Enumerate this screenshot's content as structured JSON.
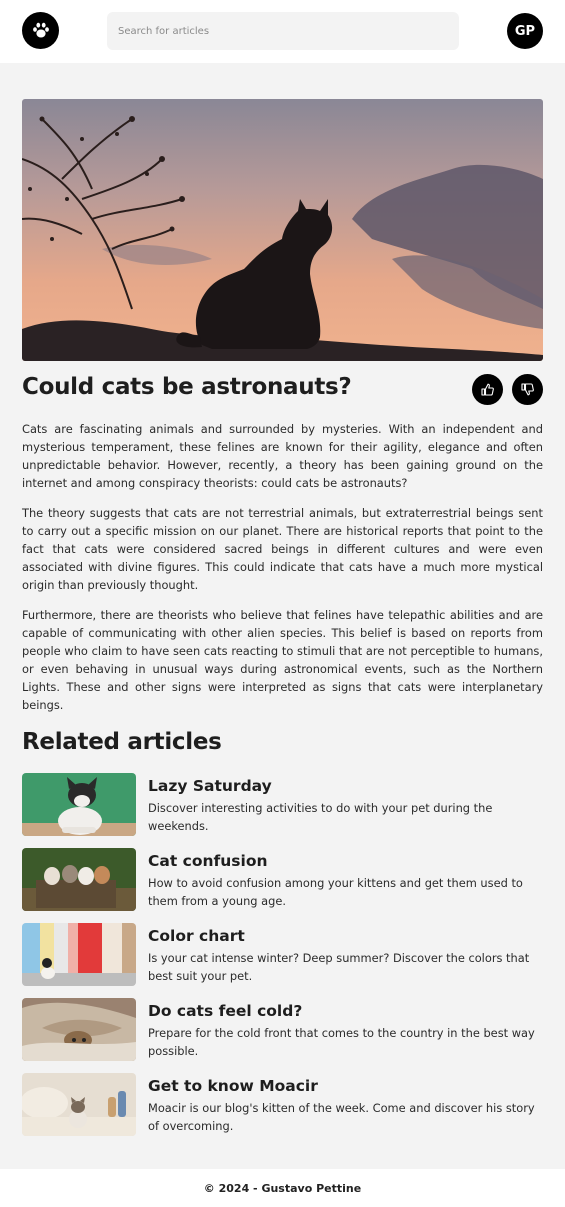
{
  "header": {
    "logo_icon": "paw-icon",
    "search_placeholder": "Search for articles",
    "avatar_initials": "GP"
  },
  "article": {
    "hero_image": "cat-silhouette-at-sunset",
    "title": "Could cats be astronauts?",
    "like_icon": "thumbs-up-icon",
    "dislike_icon": "thumbs-down-icon",
    "paragraphs": [
      "Cats are fascinating animals and surrounded by mysteries. With an independent and mysterious temperament, these felines are known for their agility, elegance and often unpredictable behavior. However, recently, a theory has been gaining ground on the internet and among conspiracy theorists: could cats be astronauts?",
      "The theory suggests that cats are not terrestrial animals, but extraterrestrial beings sent to carry out a specific mission on our planet. There are historical reports that point to the fact that cats were considered sacred beings in different cultures and were even associated with divine figures. This could indicate that cats have a much more mystical origin than previously thought.",
      "Furthermore, there are theorists who believe that felines have telepathic abilities and are capable of communicating with other alien species. This belief is based on reports from people who claim to have seen cats reacting to stimuli that are not perceptible to humans, or even behaving in unusual ways during astronomical events, such as the Northern Lights. These and other signs were interpreted as signs that cats were interplanetary beings."
    ]
  },
  "related": {
    "heading": "Related articles",
    "items": [
      {
        "title": "Lazy Saturday",
        "description": "Discover interesting activities to do with your pet during the weekends."
      },
      {
        "title": "Cat confusion",
        "description": "How to avoid confusion among your kittens and get them used to them from a young age."
      },
      {
        "title": "Color chart",
        "description": "Is your cat intense winter? Deep summer? Discover the colors that best suit your pet."
      },
      {
        "title": "Do cats feel cold?",
        "description": "Prepare for the cold front that comes to the country in the best way possible."
      },
      {
        "title": "Get to know Moacir",
        "description": "Moacir is our blog's kitten of the week. Come and discover his story of overcoming."
      }
    ]
  },
  "footer": {
    "text": "© 2024 - Gustavo Pettine"
  }
}
